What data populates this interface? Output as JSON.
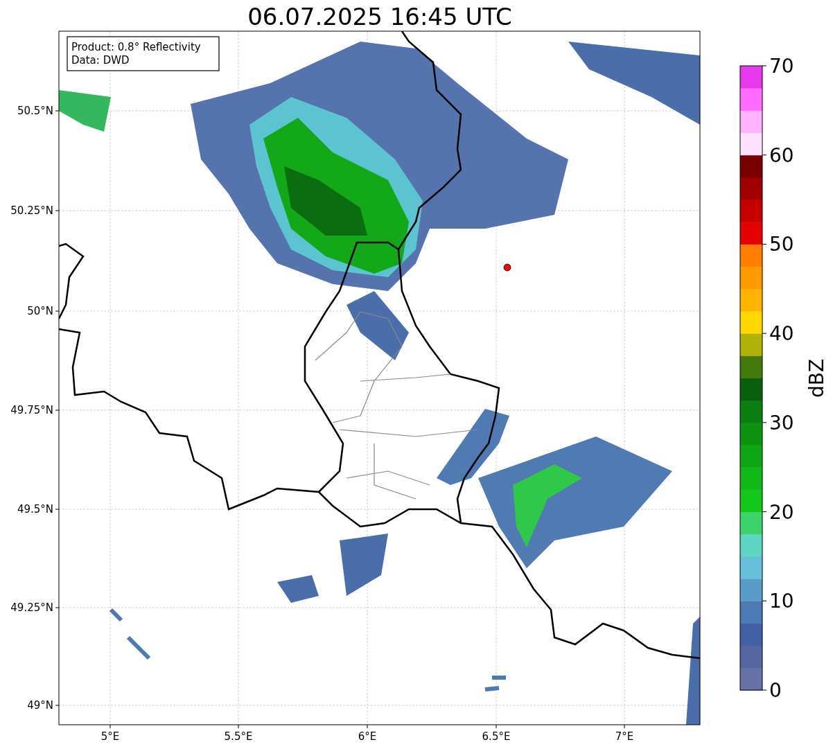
{
  "title": "06.07.2025 16:45 UTC",
  "info_box": [
    "Product: 0.8° Reflectivity",
    "Data: DWD"
  ],
  "lat_ticks": [
    "50.5°N",
    "50.25°N",
    "50°N",
    "49.75°N",
    "49.5°N",
    "49.25°N",
    "49°N"
  ],
  "lon_ticks": [
    "5°E",
    "5.5°E",
    "6°E",
    "6.5°E",
    "7°E"
  ],
  "colorbar": {
    "label": "dBZ",
    "ticks": [
      "70",
      "60",
      "50",
      "40",
      "30",
      "20",
      "10",
      "0"
    ],
    "bins": [
      {
        "color": "#6672a6"
      },
      {
        "color": "#5566a0"
      },
      {
        "color": "#4460a4"
      },
      {
        "color": "#4b7ab4"
      },
      {
        "color": "#5a9cc8"
      },
      {
        "color": "#66c0dc"
      },
      {
        "color": "#5dd6c4"
      },
      {
        "color": "#3dd46c"
      },
      {
        "color": "#12c818"
      },
      {
        "color": "#10b818"
      },
      {
        "color": "#0ea614"
      },
      {
        "color": "#0c9410"
      },
      {
        "color": "#0a7e10"
      },
      {
        "color": "#08600c"
      },
      {
        "color": "#447a0c"
      },
      {
        "color": "#b0b208"
      },
      {
        "color": "#ffd800"
      },
      {
        "color": "#ffb400"
      },
      {
        "color": "#ff9a00"
      },
      {
        "color": "#ff7e00"
      },
      {
        "color": "#e40000"
      },
      {
        "color": "#c40000"
      },
      {
        "color": "#a00000"
      },
      {
        "color": "#7a0000"
      },
      {
        "color": "#ffe0ff"
      },
      {
        "color": "#ffb4ff"
      },
      {
        "color": "#ff6cff"
      },
      {
        "color": "#e838ee"
      }
    ]
  }
}
